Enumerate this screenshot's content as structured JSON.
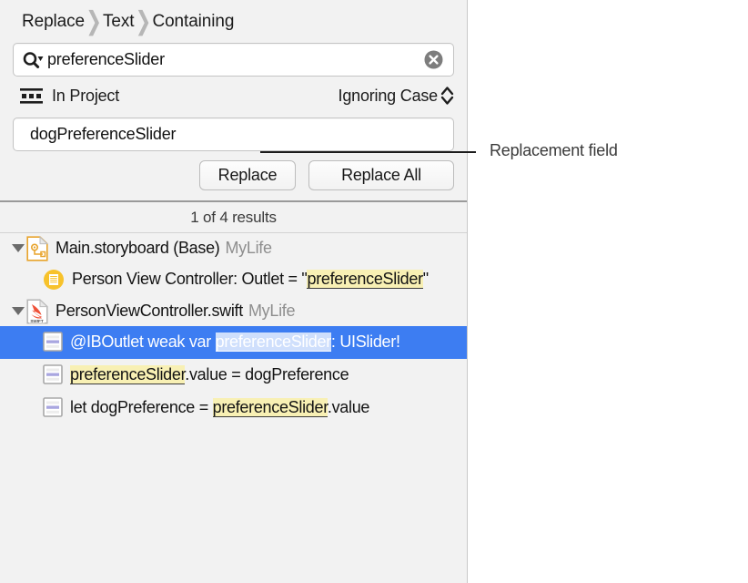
{
  "breadcrumb": {
    "items": [
      "Replace",
      "Text",
      "Containing"
    ],
    "separator": "❯"
  },
  "search": {
    "value": "preferenceSlider",
    "placeholder": "Search",
    "icon": "magnifier-with-dropdown",
    "clear_icon": "clear-circle-icon"
  },
  "scope": {
    "label": "In Project",
    "icon": "project-scope-icon",
    "case_option": "Ignoring Case",
    "stepper_icon": "up-down-chevron-icon"
  },
  "replace": {
    "value": "dogPreferenceSlider",
    "placeholder": "Replace"
  },
  "buttons": {
    "replace": "Replace",
    "replace_all": "Replace All"
  },
  "results": {
    "count_label": "1 of 4 results",
    "groups": [
      {
        "name": "Main.storyboard (Base)",
        "project": "MyLife",
        "icon": "storyboard-file-icon",
        "expanded": true,
        "matches": [
          {
            "icon": "outlet-match-icon",
            "selected": false,
            "parts": [
              {
                "text": "Person View Controller: Outlet = \"",
                "highlight": false
              },
              {
                "text": "preferenceSlider",
                "highlight": true
              },
              {
                "text": "\"",
                "highlight": false
              }
            ]
          }
        ]
      },
      {
        "name": "PersonViewController.swift",
        "project": "MyLife",
        "icon": "swift-file-icon",
        "expanded": true,
        "matches": [
          {
            "icon": "code-line-icon",
            "selected": true,
            "parts": [
              {
                "text": "@IBOutlet weak var ",
                "highlight": false
              },
              {
                "text": "preferenceSlider",
                "highlight": true
              },
              {
                "text": ": UISlider!",
                "highlight": false
              }
            ]
          },
          {
            "icon": "code-line-icon",
            "selected": false,
            "parts": [
              {
                "text": "preferenceSlider",
                "highlight": true
              },
              {
                "text": ".value = dogPreference",
                "highlight": false
              }
            ]
          },
          {
            "icon": "code-line-icon",
            "selected": false,
            "parts": [
              {
                "text": "let dogPreference = ",
                "highlight": false
              },
              {
                "text": "preferenceSlider",
                "highlight": true
              },
              {
                "text": ".value",
                "highlight": false
              }
            ]
          }
        ]
      }
    ]
  },
  "callout": {
    "label": "Replacement field"
  },
  "colors": {
    "selection_blue": "#3d7df2",
    "highlight_yellow": "#f8f0b4",
    "panel_background": "#f2f2f2",
    "swift_orange": "#ef5138",
    "storyboard_orange": "#f0a32a",
    "outlet_yellow": "#f7c22b"
  }
}
